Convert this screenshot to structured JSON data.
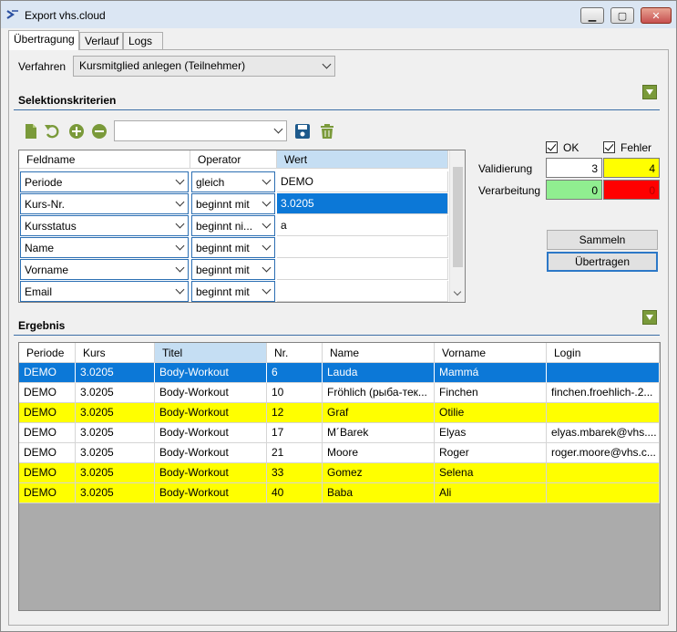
{
  "window": {
    "title": "Export vhs.cloud",
    "minimize_glyph": "▁",
    "maximize_glyph": "▢",
    "close_glyph": "✕"
  },
  "tabs": [
    {
      "label": "Übertragung",
      "active": true
    },
    {
      "label": "Verlauf",
      "active": false
    },
    {
      "label": "Logs",
      "active": false
    }
  ],
  "verfahren": {
    "label": "Verfahren",
    "value": "Kursmitglied anlegen (Teilnehmer)"
  },
  "selektion": {
    "title": "Selektionskriterien",
    "toolbar_icons": [
      "new-document-icon",
      "undo-icon",
      "add-icon",
      "remove-icon",
      "save-icon",
      "delete-icon"
    ],
    "filter_combo_value": "",
    "columns": [
      "Feldname",
      "Operator",
      "Wert"
    ],
    "rows": [
      {
        "feld": "Periode",
        "operator": "gleich",
        "wert": "DEMO",
        "selected": false
      },
      {
        "feld": "Kurs-Nr.",
        "operator": "beginnt mit",
        "wert": "3.0205",
        "selected": true
      },
      {
        "feld": "Kursstatus",
        "operator": "beginnt ni...",
        "wert": "a",
        "selected": false
      },
      {
        "feld": "Name",
        "operator": "beginnt mit",
        "wert": "",
        "selected": false
      },
      {
        "feld": "Vorname",
        "operator": "beginnt mit",
        "wert": "",
        "selected": false
      },
      {
        "feld": "Email",
        "operator": "beginnt mit",
        "wert": "",
        "selected": false
      }
    ]
  },
  "status": {
    "ok_label": "OK",
    "fehler_label": "Fehler",
    "validierung_label": "Validierung",
    "verarbeitung_label": "Verarbeitung",
    "validierung_ok": "3",
    "validierung_fehler": "4",
    "verarbeitung_ok": "0",
    "verarbeitung_fehler": "0",
    "colors": {
      "validierung_fehler": "#ffff00",
      "verarbeitung_ok": "#90ee90",
      "verarbeitung_fehler": "#ff0000"
    }
  },
  "buttons": {
    "sammeln": "Sammeln",
    "uebertragen": "Übertragen"
  },
  "ergebnis": {
    "title": "Ergebnis",
    "columns": [
      "Periode",
      "Kurs",
      "Titel",
      "Nr.",
      "Name",
      "Vorname",
      "Login"
    ],
    "rows": [
      {
        "periode": "DEMO",
        "kurs": "3.0205",
        "titel": "Body-Workout",
        "nr": "6",
        "name": "Lauda",
        "vorname": "Mammá",
        "login": "",
        "style": "selected"
      },
      {
        "periode": "DEMO",
        "kurs": "3.0205",
        "titel": "Body-Workout",
        "nr": "10",
        "name": "Fröhlich (рыба-тек...",
        "vorname": "Finchen",
        "login": "finchen.froehlich-.2...",
        "style": "white"
      },
      {
        "periode": "DEMO",
        "kurs": "3.0205",
        "titel": "Body-Workout",
        "nr": "12",
        "name": "Graf",
        "vorname": "Otilie",
        "login": "",
        "style": "yellow"
      },
      {
        "periode": "DEMO",
        "kurs": "3.0205",
        "titel": "Body-Workout",
        "nr": "17",
        "name": "M´Barek",
        "vorname": "Elyas",
        "login": "elyas.mbarek@vhs....",
        "style": "white"
      },
      {
        "periode": "DEMO",
        "kurs": "3.0205",
        "titel": "Body-Workout",
        "nr": "21",
        "name": "Moore",
        "vorname": "Roger",
        "login": "roger.moore@vhs.c...",
        "style": "white"
      },
      {
        "periode": "DEMO",
        "kurs": "3.0205",
        "titel": "Body-Workout",
        "nr": "33",
        "name": "Gomez",
        "vorname": "Selena",
        "login": "",
        "style": "yellow"
      },
      {
        "periode": "DEMO",
        "kurs": "3.0205",
        "titel": "Body-Workout",
        "nr": "40",
        "name": "Baba",
        "vorname": "Ali",
        "login": "",
        "style": "yellow"
      }
    ]
  }
}
